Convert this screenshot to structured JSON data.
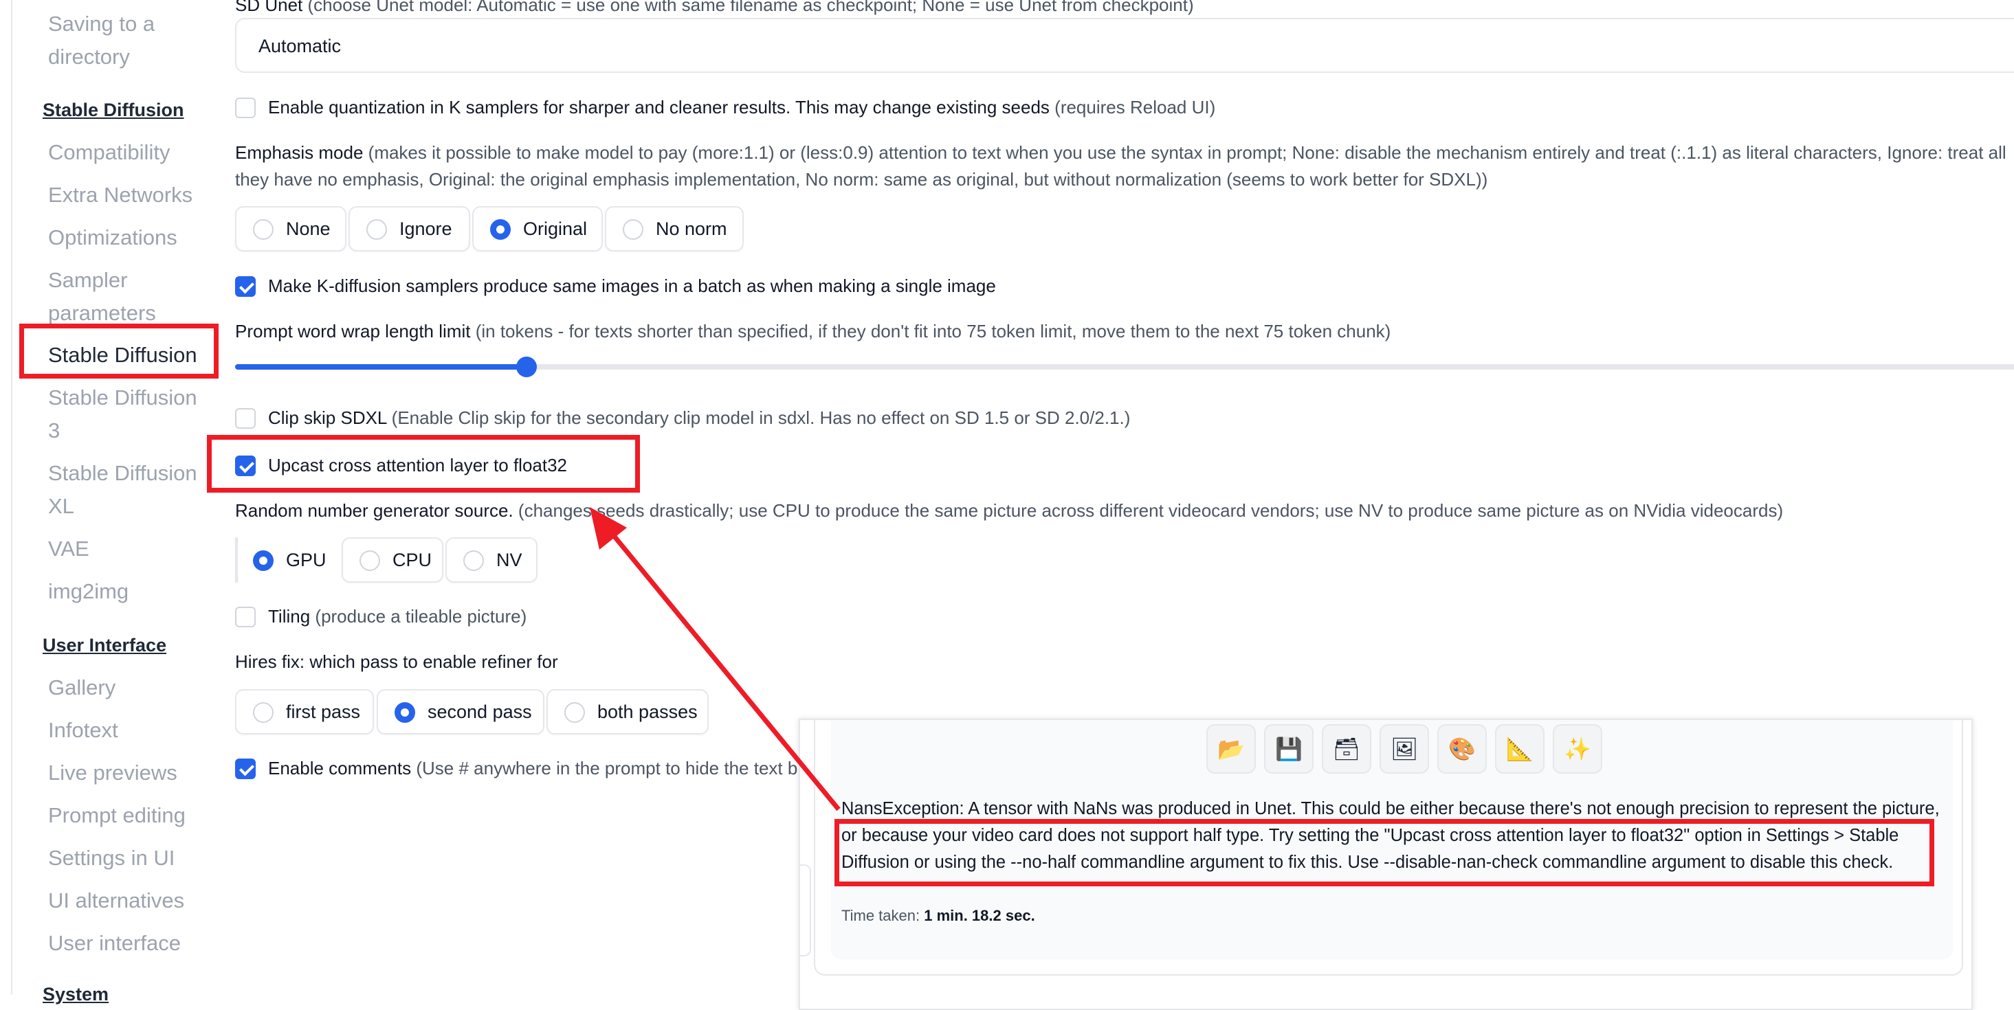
{
  "sidebar": {
    "items_top": [
      "Saving to a",
      "directory"
    ],
    "section_sd": "Stable Diffusion",
    "sd_items": [
      "Compatibility",
      "Extra Networks",
      "Optimizations",
      "Sampler",
      "parameters",
      "Stable Diffusion",
      "Stable Diffusion",
      "3",
      "Stable Diffusion",
      "XL",
      "VAE",
      "img2img"
    ],
    "section_ui": "User Interface",
    "ui_items": [
      "Gallery",
      "Infotext",
      "Live previews",
      "Prompt editing",
      "Settings in UI",
      "UI alternatives",
      "User interface"
    ],
    "section_system": "System"
  },
  "settings": {
    "sd_unet_label": "SD Unet",
    "sd_unet_hint": "(choose Unet model: Automatic = use one with same filename as checkpoint; None = use Unet from checkpoint)",
    "sd_unet_value": "Automatic",
    "quant_label": "Enable quantization in K samplers for sharper and cleaner results. This may change existing seeds",
    "quant_hint": "(requires Reload UI)",
    "quant_checked": false,
    "emphasis_label": "Emphasis mode",
    "emphasis_hint_1": "(makes it possible to make model to pay (more:1.1) or (less:0.9) attention to text when you use the syntax in prompt; None: disable the mechanism entirely and treat (:.1.1) as literal characters, Ignore: treat all",
    "emphasis_hint_2": "they have no emphasis, Original: the original emphasis implementation, No norm: same as original, but without normalization (seems to work better for SDXL))",
    "emphasis_options": [
      "None",
      "Ignore",
      "Original",
      "No norm"
    ],
    "emphasis_selected": "Original",
    "batch_label": "Make K-diffusion samplers produce same images in a batch as when making a single image",
    "batch_checked": true,
    "wrap_label": "Prompt word wrap length limit",
    "wrap_hint": "(in tokens - for texts shorter than specified, if they don't fit into 75 token limit, move them to the next 75 token chunk)",
    "wrap_fraction": 0.162,
    "clip_label": "Clip skip SDXL",
    "clip_hint": "(Enable Clip skip for the secondary clip model in sdxl. Has no effect on SD 1.5 or SD 2.0/2.1.)",
    "clip_checked": false,
    "upcast_label": "Upcast cross attention layer to float32",
    "upcast_checked": true,
    "rng_label": "Random number generator source.",
    "rng_hint": "(changes seeds drastically; use CPU to produce the same picture across different videocard vendors; use NV to produce same picture as on NVidia videocards)",
    "rng_options": [
      "GPU",
      "CPU",
      "NV"
    ],
    "rng_selected": "GPU",
    "tiling_label": "Tiling",
    "tiling_hint": "(produce a tileable picture)",
    "tiling_checked": false,
    "hires_label": "Hires fix: which pass to enable refiner for",
    "hires_options": [
      "first pass",
      "second pass",
      "both passes"
    ],
    "hires_selected": "second pass",
    "comments_label": "Enable comments",
    "comments_hint": "(Use # anywhere in the prompt to hide the text b",
    "comments_checked": true
  },
  "overlay": {
    "tool_icons": [
      "folder-icon",
      "save-icon",
      "archive-icon",
      "image-icon",
      "palette-icon",
      "ruler-icon",
      "sparkle-icon"
    ],
    "tool_glyphs": [
      "📂",
      "💾",
      "🗃",
      "🖼",
      "🎨",
      "📐",
      "✨"
    ],
    "error_text": "NansException: A tensor with NaNs was produced in Unet. This could be either because there's not enough precision to represent the picture, or because your video card does not support half type. Try setting the \"Upcast cross attention layer to float32\" option in Settings > Stable Diffusion or using the --no-half commandline argument to fix this. Use --disable-nan-check commandline argument to disable this check.",
    "time_label": "Time taken:",
    "time_value": "1 min. 18.2 sec."
  },
  "colors": {
    "accent": "#2563eb",
    "annotation": "#ee1c25"
  }
}
